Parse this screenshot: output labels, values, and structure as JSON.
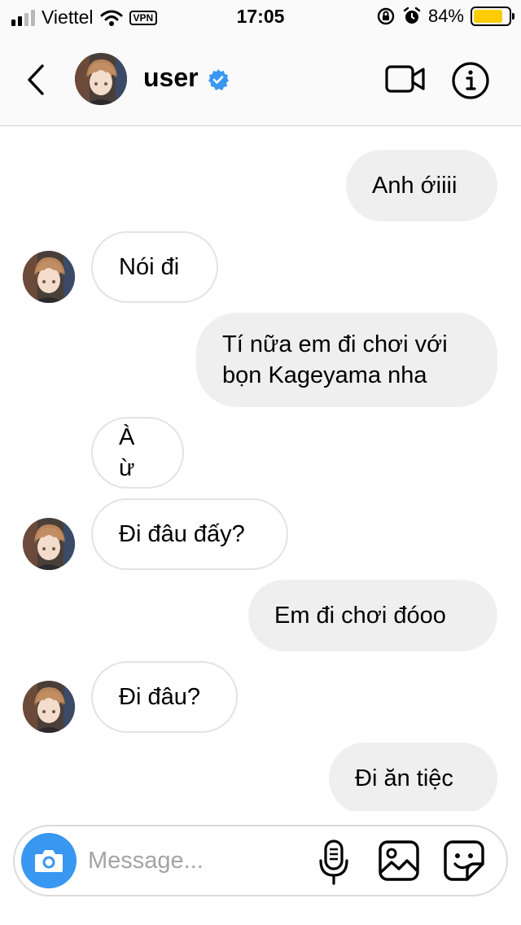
{
  "status_bar": {
    "carrier": "Viettel",
    "vpn": "VPN",
    "time": "17:05",
    "battery_percent": "84%",
    "battery_level": 0.84,
    "battery_color": "#ffcc00"
  },
  "header": {
    "username": "user",
    "verified": true,
    "icons": [
      "chevron-left-icon",
      "video-camera-icon",
      "info-icon"
    ]
  },
  "colors": {
    "accent": "#3897f0",
    "sent_bubble": "#efefef",
    "received_border": "#e3e3e3"
  },
  "messages": [
    {
      "from": "me",
      "text": "Anh ớiiii"
    },
    {
      "from": "them",
      "text": "Nói đi",
      "avatar": true
    },
    {
      "from": "me",
      "lines": [
        "Tí nữa em đi chơi với",
        "bọn Kageyama nha"
      ]
    },
    {
      "from": "them",
      "text": "À ừ",
      "avatar": false
    },
    {
      "from": "them",
      "text": "Đi đâu đấy?",
      "avatar": true
    },
    {
      "from": "me",
      "text": "Em đi chơi đóoo"
    },
    {
      "from": "them",
      "text": "Đi đâu?",
      "avatar": true
    },
    {
      "from": "me",
      "text": "Đi ăn tiệc"
    }
  ],
  "composer": {
    "placeholder": "Message...",
    "value": "",
    "icons": [
      "camera-icon",
      "microphone-icon",
      "gallery-icon",
      "sticker-icon"
    ]
  }
}
